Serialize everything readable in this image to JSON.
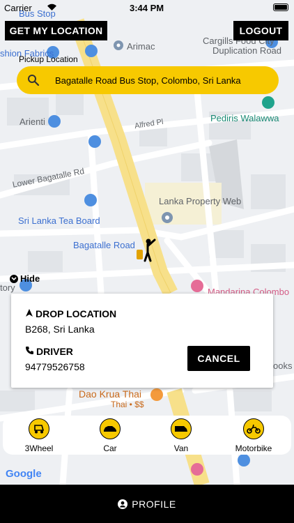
{
  "status_bar": {
    "carrier": "Carrier",
    "time": "3:44 PM"
  },
  "top_buttons": {
    "get_location": "GET MY LOCATION",
    "logout": "LOGOUT"
  },
  "pickup": {
    "label": "Pickup Location",
    "value": "Bagatalle Road Bus Stop, Colombo, Sri Lanka"
  },
  "map": {
    "labels": {
      "bus_stop": "Bus Stop",
      "fashion_fabrics": "shion Fabrics",
      "arimac": "Arimac",
      "cargills": "Cargills Food City",
      "duplication_road": "Duplication Road",
      "arienti": "Arienti",
      "pediris": "Pediris Walawwa",
      "alfred": "Alfred Pl",
      "lower_bagatalle": "Lower Bagatalle Rd",
      "lanka_property": "Lanka Property Web",
      "tea_board": "Sri Lanka Tea Board",
      "bagatalle_road": "Bagatalle Road",
      "hide": "Hide",
      "tory": "tory",
      "mandarina": "Mandarina Colombo",
      "books": "ooks",
      "dao_krua": "Dao Krua Thai",
      "dao_sub": "Thai • $$",
      "google": "Google"
    }
  },
  "card": {
    "drop_title": "DROP LOCATION",
    "drop_value": "B268, Sri Lanka",
    "driver_title": "DRIVER",
    "driver_phone": "94779526758",
    "cancel": "CANCEL"
  },
  "vehicles": [
    {
      "label": "3Wheel",
      "icon": "tuk-tuk-icon"
    },
    {
      "label": "Car",
      "icon": "car-icon"
    },
    {
      "label": "Van",
      "icon": "van-icon"
    },
    {
      "label": "Motorbike",
      "icon": "motorbike-icon"
    }
  ],
  "bottom": {
    "profile": "PROFILE"
  },
  "colors": {
    "accent": "#f7c900",
    "dark": "#000000",
    "map_bg": "#eef0f3",
    "road": "#f7e08a"
  }
}
